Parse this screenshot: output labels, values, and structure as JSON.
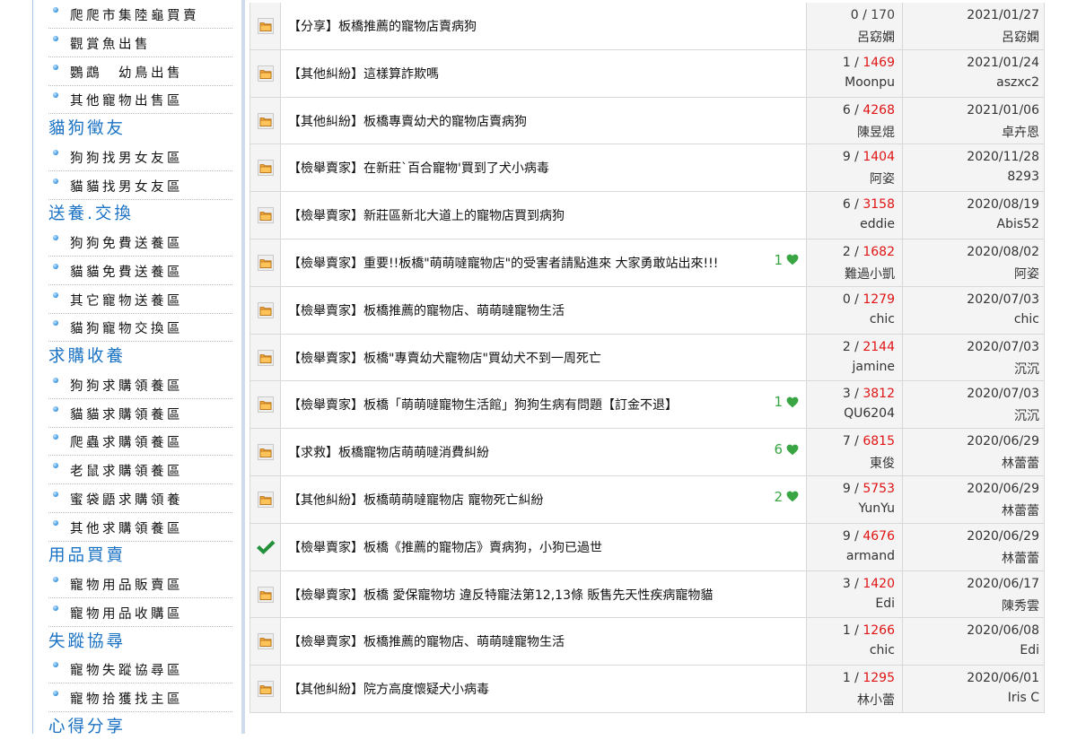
{
  "colors": {
    "category": "#1a72c4",
    "views_hot": "#e01414",
    "likes": "#3aa543",
    "cell_gray": "#f4f4f4",
    "border": "#d8d8d8"
  },
  "sidebar": [
    {
      "type": "item",
      "label": "爬爬市集陸龜買賣"
    },
    {
      "type": "item",
      "label": "觀賞魚出售"
    },
    {
      "type": "item",
      "label": "鸚鵡　幼鳥出售"
    },
    {
      "type": "item",
      "label": "其他寵物出售區"
    },
    {
      "type": "category",
      "label": "貓狗徵友"
    },
    {
      "type": "item",
      "label": "狗狗找男女友區"
    },
    {
      "type": "item",
      "label": "貓貓找男女友區"
    },
    {
      "type": "category",
      "label": "送養.交換"
    },
    {
      "type": "item",
      "label": "狗狗免費送養區"
    },
    {
      "type": "item",
      "label": "貓貓免費送養區"
    },
    {
      "type": "item",
      "label": "其它寵物送養區"
    },
    {
      "type": "item",
      "label": "貓狗寵物交換區"
    },
    {
      "type": "category",
      "label": "求購收養"
    },
    {
      "type": "item",
      "label": "狗狗求購領養區"
    },
    {
      "type": "item",
      "label": "貓貓求購領養區"
    },
    {
      "type": "item",
      "label": "爬蟲求購領養區"
    },
    {
      "type": "item",
      "label": "老鼠求購領養區"
    },
    {
      "type": "item",
      "label": "蜜袋鼯求購領養"
    },
    {
      "type": "item",
      "label": "其他求購領養區"
    },
    {
      "type": "category",
      "label": "用品買賣"
    },
    {
      "type": "item",
      "label": "寵物用品販賣區"
    },
    {
      "type": "item",
      "label": "寵物用品收購區"
    },
    {
      "type": "category",
      "label": "失蹤協尋"
    },
    {
      "type": "item",
      "label": "寵物失蹤協尋區"
    },
    {
      "type": "item",
      "label": "寵物拾獲找主區"
    },
    {
      "type": "category",
      "label": "心得分享"
    }
  ],
  "threads": [
    {
      "icon": "folder-icon",
      "title": "【分享】板橋推薦的寵物店賣病狗",
      "likes": "",
      "replies": "0",
      "views": "170",
      "views_hot": false,
      "author": "呂窈嫻",
      "date": "2021/01/27",
      "last_poster": "呂窈嫻"
    },
    {
      "icon": "folder-icon",
      "title": "【其他糾紛】這樣算詐欺嗎",
      "likes": "",
      "replies": "1",
      "views": "1469",
      "views_hot": true,
      "author": "Moonpu",
      "date": "2021/01/24",
      "last_poster": "aszxc2"
    },
    {
      "icon": "folder-icon",
      "title": "【其他糾紛】板橋專賣幼犬的寵物店賣病狗",
      "likes": "",
      "replies": "6",
      "views": "4268",
      "views_hot": true,
      "author": "陳昱焜",
      "date": "2021/01/06",
      "last_poster": "卓卉恩"
    },
    {
      "icon": "folder-icon",
      "title": "【檢舉賣家】在新莊`百合寵物'買到了犬小病毒",
      "likes": "",
      "replies": "9",
      "views": "1404",
      "views_hot": true,
      "author": "阿姿",
      "date": "2020/11/28",
      "last_poster": "8293"
    },
    {
      "icon": "folder-icon",
      "title": "【檢舉賣家】新莊區新北大道上的寵物店買到病狗",
      "likes": "",
      "replies": "6",
      "views": "3158",
      "views_hot": true,
      "author": "eddie",
      "date": "2020/08/19",
      "last_poster": "Abis52"
    },
    {
      "icon": "folder-icon",
      "title": "【檢舉賣家】重要!!板橋\"萌萌噠寵物店\"的受害者請點進來 大家勇敢站出來!!!",
      "likes": "1",
      "replies": "2",
      "views": "1682",
      "views_hot": true,
      "author": "難過小凱",
      "date": "2020/08/02",
      "last_poster": "阿姿"
    },
    {
      "icon": "folder-icon",
      "title": "【檢舉賣家】板橋推薦的寵物店、萌萌噠寵物生活",
      "likes": "",
      "replies": "0",
      "views": "1279",
      "views_hot": true,
      "author": "chic",
      "date": "2020/07/03",
      "last_poster": "chic"
    },
    {
      "icon": "folder-icon",
      "title": "【檢舉賣家】板橋\"專賣幼犬寵物店\"買幼犬不到一周死亡",
      "likes": "",
      "replies": "2",
      "views": "2144",
      "views_hot": true,
      "author": "jamine",
      "date": "2020/07/03",
      "last_poster": "沉沉"
    },
    {
      "icon": "folder-icon",
      "title": "【檢舉賣家】板橋「萌萌噠寵物生活館」狗狗生病有問題【訂金不退】",
      "likes": "1",
      "replies": "3",
      "views": "3812",
      "views_hot": true,
      "author": "QU6204",
      "date": "2020/07/03",
      "last_poster": "沉沉"
    },
    {
      "icon": "folder-icon",
      "title": "【求救】板橋寵物店萌萌噠消費糾紛",
      "likes": "6",
      "replies": "7",
      "views": "6815",
      "views_hot": true,
      "author": "東俊",
      "date": "2020/06/29",
      "last_poster": "林蕾蕾"
    },
    {
      "icon": "folder-icon",
      "title": "【其他糾紛】板橋萌萌噠寵物店 寵物死亡糾紛",
      "likes": "2",
      "replies": "9",
      "views": "5753",
      "views_hot": true,
      "author": "YunYu",
      "date": "2020/06/29",
      "last_poster": "林蕾蕾"
    },
    {
      "icon": "check-icon",
      "title": "【檢舉賣家】板橋《推薦的寵物店》賣病狗，小狗已過世",
      "likes": "",
      "replies": "9",
      "views": "4676",
      "views_hot": true,
      "author": "armand",
      "date": "2020/06/29",
      "last_poster": "林蕾蕾"
    },
    {
      "icon": "folder-icon",
      "title": "【檢舉賣家】板橋 愛保寵物坊 違反特寵法第12,13條 販售先天性疾病寵物貓",
      "likes": "",
      "replies": "3",
      "views": "1420",
      "views_hot": true,
      "author": "Edi",
      "date": "2020/06/17",
      "last_poster": "陳秀雲"
    },
    {
      "icon": "folder-icon",
      "title": "【檢舉賣家】板橋推薦的寵物店、萌萌噠寵物生活",
      "likes": "",
      "replies": "1",
      "views": "1266",
      "views_hot": true,
      "author": "chic",
      "date": "2020/06/08",
      "last_poster": "Edi"
    },
    {
      "icon": "folder-icon",
      "title": "【其他糾紛】院方高度懷疑犬小病毒",
      "likes": "",
      "replies": "1",
      "views": "1295",
      "views_hot": true,
      "author": "林小蕾",
      "date": "2020/06/01",
      "last_poster": "Iris C"
    }
  ]
}
